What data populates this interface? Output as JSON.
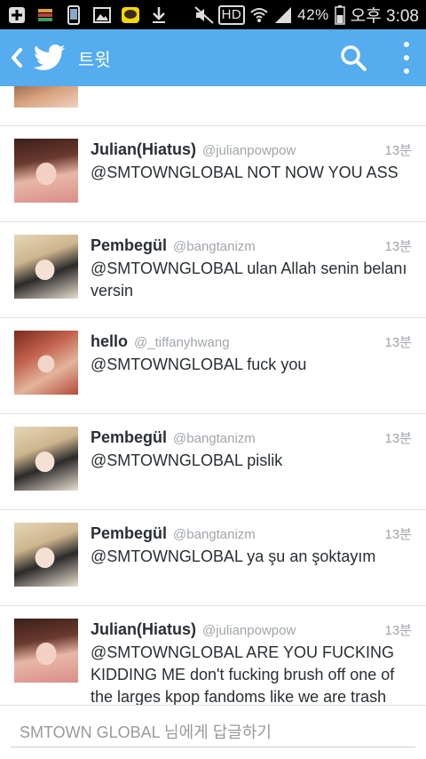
{
  "status_bar": {
    "battery_percent": "42%",
    "clock": "오후 3:08",
    "hd_label": "HD"
  },
  "app_bar": {
    "title": "트윗",
    "accent_color": "#55acee",
    "icons": [
      "back-icon",
      "twitter-bird-icon",
      "search-icon",
      "overflow-menu-icon"
    ]
  },
  "tweets": [
    {
      "name": "Julian(Hiatus)",
      "handle": "@julianpowpow",
      "time": "13분",
      "text": "@SMTOWNGLOBAL NOT NOW YOU ASS"
    },
    {
      "name": "Pembegül",
      "handle": "@bangtanizm",
      "time": "13분",
      "text": "@SMTOWNGLOBAL ulan Allah senin belanı versin"
    },
    {
      "name": "hello",
      "handle": "@_tiffanyhwang",
      "time": "13분",
      "text": "@SMTOWNGLOBAL fuck you"
    },
    {
      "name": "Pembegül",
      "handle": "@bangtanizm",
      "time": "13분",
      "text": "@SMTOWNGLOBAL pislik"
    },
    {
      "name": "Pembegül",
      "handle": "@bangtanizm",
      "time": "13분",
      "text": "@SMTOWNGLOBAL ya şu an şoktayım"
    },
    {
      "name": "Julian(Hiatus)",
      "handle": "@julianpowpow",
      "time": "13분",
      "text": "@SMTOWNGLOBAL ARE YOU FUCKING KIDDING ME don't fucking brush off one of the larges kpop fandoms like we are trash"
    }
  ],
  "reply": {
    "placeholder": "SMTOWN GLOBAL 님에게 답글하기"
  }
}
